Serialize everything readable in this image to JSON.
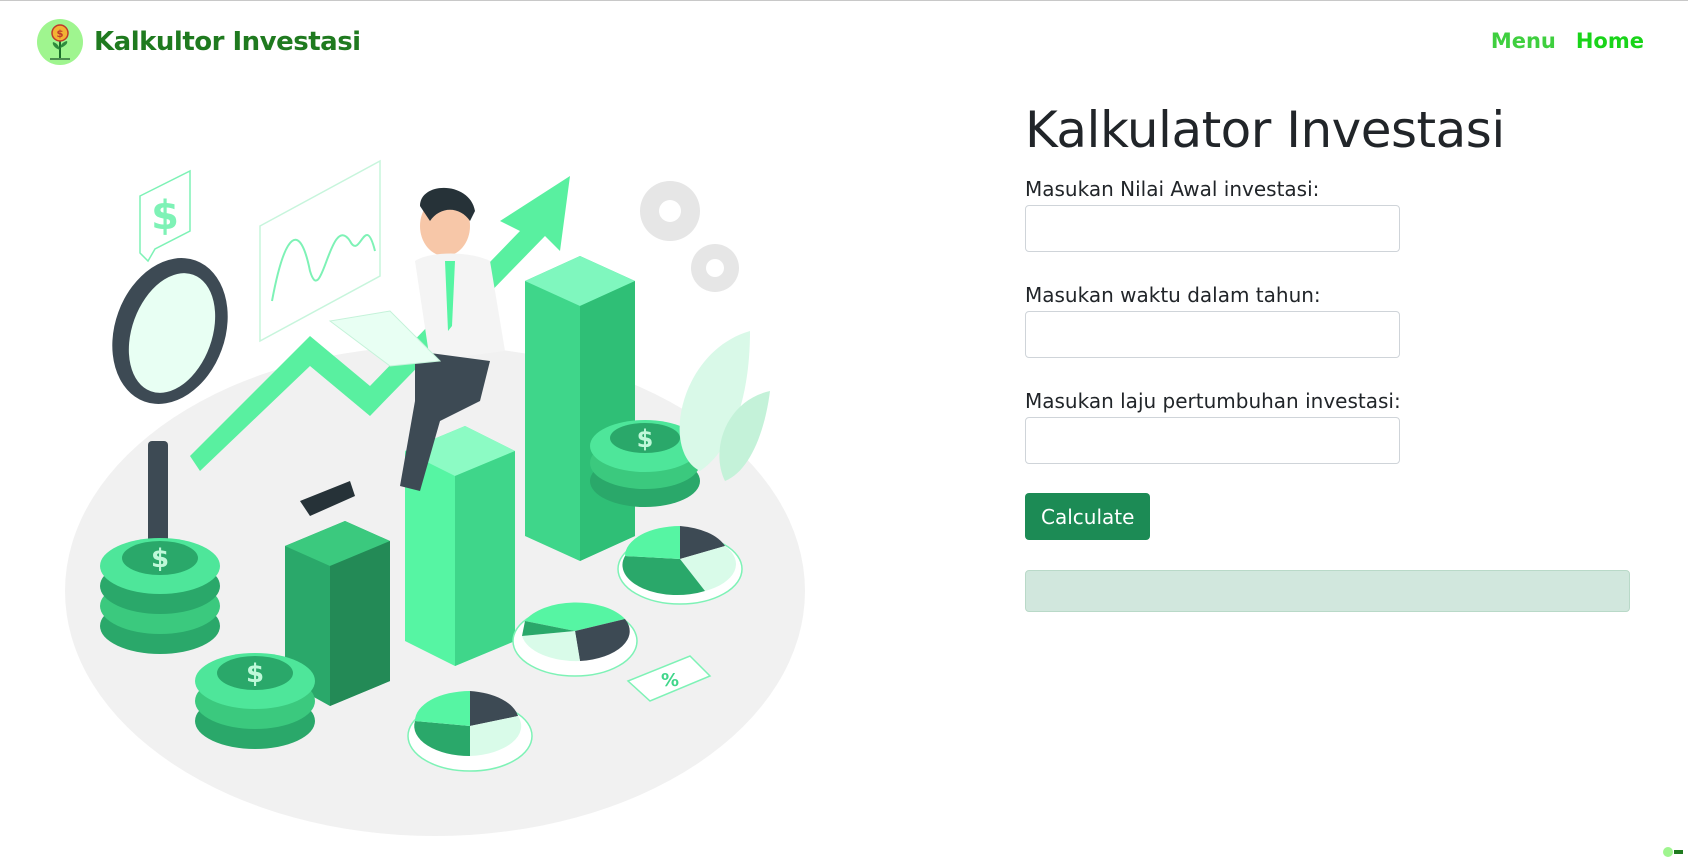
{
  "navbar": {
    "brand_name": "Kalkultor Investasi",
    "logo_icon": "money-plant-icon",
    "links": [
      {
        "label": "Menu"
      },
      {
        "label": "Home"
      }
    ]
  },
  "illustration": {
    "icon": "investment-growth-illustration"
  },
  "form": {
    "title": "Kalkulator Investasi",
    "fields": [
      {
        "label": "Masukan Nilai Awal investasi:",
        "value": "",
        "placeholder": ""
      },
      {
        "label": "Masukan waktu dalam tahun:",
        "value": "",
        "placeholder": ""
      },
      {
        "label": "Masukan laju pertumbuhan investasi:",
        "value": "",
        "placeholder": ""
      }
    ],
    "button_label": "Calculate",
    "result_text": ""
  },
  "colors": {
    "brand": "#1f7a1f",
    "nav_link": "#3fcf3f",
    "button": "#1c8b55",
    "result_bg": "#d1e7dd",
    "illustration_green": "#4eea9a"
  }
}
